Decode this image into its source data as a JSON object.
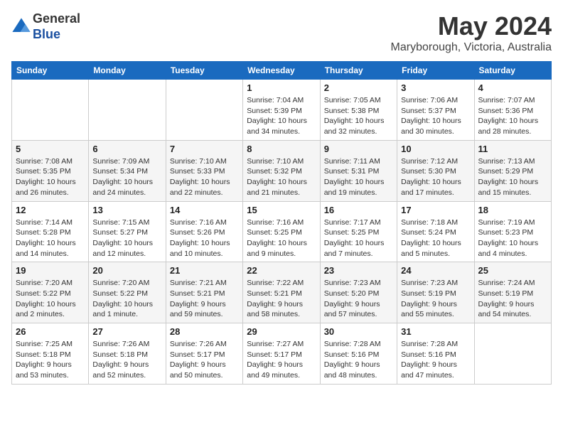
{
  "logo": {
    "line1": "General",
    "line2": "Blue"
  },
  "title": "May 2024",
  "location": "Maryborough, Victoria, Australia",
  "headers": [
    "Sunday",
    "Monday",
    "Tuesday",
    "Wednesday",
    "Thursday",
    "Friday",
    "Saturday"
  ],
  "weeks": [
    [
      {
        "day": "",
        "info": ""
      },
      {
        "day": "",
        "info": ""
      },
      {
        "day": "",
        "info": ""
      },
      {
        "day": "1",
        "info": "Sunrise: 7:04 AM\nSunset: 5:39 PM\nDaylight: 10 hours\nand 34 minutes."
      },
      {
        "day": "2",
        "info": "Sunrise: 7:05 AM\nSunset: 5:38 PM\nDaylight: 10 hours\nand 32 minutes."
      },
      {
        "day": "3",
        "info": "Sunrise: 7:06 AM\nSunset: 5:37 PM\nDaylight: 10 hours\nand 30 minutes."
      },
      {
        "day": "4",
        "info": "Sunrise: 7:07 AM\nSunset: 5:36 PM\nDaylight: 10 hours\nand 28 minutes."
      }
    ],
    [
      {
        "day": "5",
        "info": "Sunrise: 7:08 AM\nSunset: 5:35 PM\nDaylight: 10 hours\nand 26 minutes."
      },
      {
        "day": "6",
        "info": "Sunrise: 7:09 AM\nSunset: 5:34 PM\nDaylight: 10 hours\nand 24 minutes."
      },
      {
        "day": "7",
        "info": "Sunrise: 7:10 AM\nSunset: 5:33 PM\nDaylight: 10 hours\nand 22 minutes."
      },
      {
        "day": "8",
        "info": "Sunrise: 7:10 AM\nSunset: 5:32 PM\nDaylight: 10 hours\nand 21 minutes."
      },
      {
        "day": "9",
        "info": "Sunrise: 7:11 AM\nSunset: 5:31 PM\nDaylight: 10 hours\nand 19 minutes."
      },
      {
        "day": "10",
        "info": "Sunrise: 7:12 AM\nSunset: 5:30 PM\nDaylight: 10 hours\nand 17 minutes."
      },
      {
        "day": "11",
        "info": "Sunrise: 7:13 AM\nSunset: 5:29 PM\nDaylight: 10 hours\nand 15 minutes."
      }
    ],
    [
      {
        "day": "12",
        "info": "Sunrise: 7:14 AM\nSunset: 5:28 PM\nDaylight: 10 hours\nand 14 minutes."
      },
      {
        "day": "13",
        "info": "Sunrise: 7:15 AM\nSunset: 5:27 PM\nDaylight: 10 hours\nand 12 minutes."
      },
      {
        "day": "14",
        "info": "Sunrise: 7:16 AM\nSunset: 5:26 PM\nDaylight: 10 hours\nand 10 minutes."
      },
      {
        "day": "15",
        "info": "Sunrise: 7:16 AM\nSunset: 5:25 PM\nDaylight: 10 hours\nand 9 minutes."
      },
      {
        "day": "16",
        "info": "Sunrise: 7:17 AM\nSunset: 5:25 PM\nDaylight: 10 hours\nand 7 minutes."
      },
      {
        "day": "17",
        "info": "Sunrise: 7:18 AM\nSunset: 5:24 PM\nDaylight: 10 hours\nand 5 minutes."
      },
      {
        "day": "18",
        "info": "Sunrise: 7:19 AM\nSunset: 5:23 PM\nDaylight: 10 hours\nand 4 minutes."
      }
    ],
    [
      {
        "day": "19",
        "info": "Sunrise: 7:20 AM\nSunset: 5:22 PM\nDaylight: 10 hours\nand 2 minutes."
      },
      {
        "day": "20",
        "info": "Sunrise: 7:20 AM\nSunset: 5:22 PM\nDaylight: 10 hours\nand 1 minute."
      },
      {
        "day": "21",
        "info": "Sunrise: 7:21 AM\nSunset: 5:21 PM\nDaylight: 9 hours\nand 59 minutes."
      },
      {
        "day": "22",
        "info": "Sunrise: 7:22 AM\nSunset: 5:21 PM\nDaylight: 9 hours\nand 58 minutes."
      },
      {
        "day": "23",
        "info": "Sunrise: 7:23 AM\nSunset: 5:20 PM\nDaylight: 9 hours\nand 57 minutes."
      },
      {
        "day": "24",
        "info": "Sunrise: 7:23 AM\nSunset: 5:19 PM\nDaylight: 9 hours\nand 55 minutes."
      },
      {
        "day": "25",
        "info": "Sunrise: 7:24 AM\nSunset: 5:19 PM\nDaylight: 9 hours\nand 54 minutes."
      }
    ],
    [
      {
        "day": "26",
        "info": "Sunrise: 7:25 AM\nSunset: 5:18 PM\nDaylight: 9 hours\nand 53 minutes."
      },
      {
        "day": "27",
        "info": "Sunrise: 7:26 AM\nSunset: 5:18 PM\nDaylight: 9 hours\nand 52 minutes."
      },
      {
        "day": "28",
        "info": "Sunrise: 7:26 AM\nSunset: 5:17 PM\nDaylight: 9 hours\nand 50 minutes."
      },
      {
        "day": "29",
        "info": "Sunrise: 7:27 AM\nSunset: 5:17 PM\nDaylight: 9 hours\nand 49 minutes."
      },
      {
        "day": "30",
        "info": "Sunrise: 7:28 AM\nSunset: 5:16 PM\nDaylight: 9 hours\nand 48 minutes."
      },
      {
        "day": "31",
        "info": "Sunrise: 7:28 AM\nSunset: 5:16 PM\nDaylight: 9 hours\nand 47 minutes."
      },
      {
        "day": "",
        "info": ""
      }
    ]
  ]
}
